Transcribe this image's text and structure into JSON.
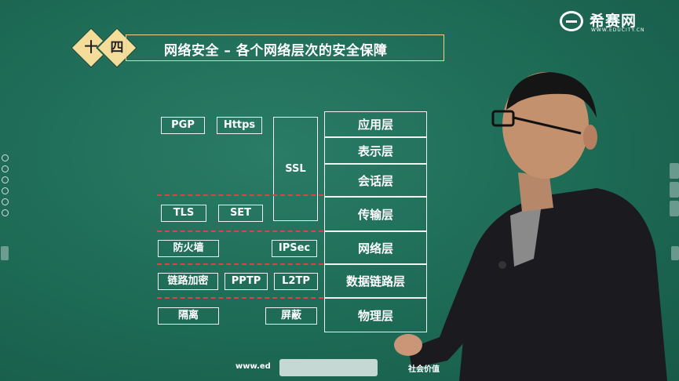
{
  "header": {
    "badge_1": "十",
    "badge_2": "四",
    "title": "网络安全 – 各个网络层次的安全保障"
  },
  "logo": {
    "name": "希赛网",
    "sub": "WWW.EDUCITY.CN"
  },
  "protocols": {
    "pgp": "PGP",
    "https": "Https",
    "ssl": "SSL",
    "tls": "TLS",
    "set": "SET",
    "firewall": "防火墙",
    "ipsec": "IPSec",
    "link_encryption": "链路加密",
    "pptp": "PPTP",
    "l2tp": "L2TP",
    "isolation": "隔离",
    "shielding": "屏蔽"
  },
  "layers": [
    "应用层",
    "表示层",
    "会话层",
    "传输层",
    "网络层",
    "数据链路层",
    "物理层"
  ],
  "footer": {
    "url": "www.ed",
    "slogan": "社会价值"
  },
  "colors": {
    "board": "#1e6b57",
    "accent": "#f4dc9a",
    "divider": "#e0404a"
  }
}
